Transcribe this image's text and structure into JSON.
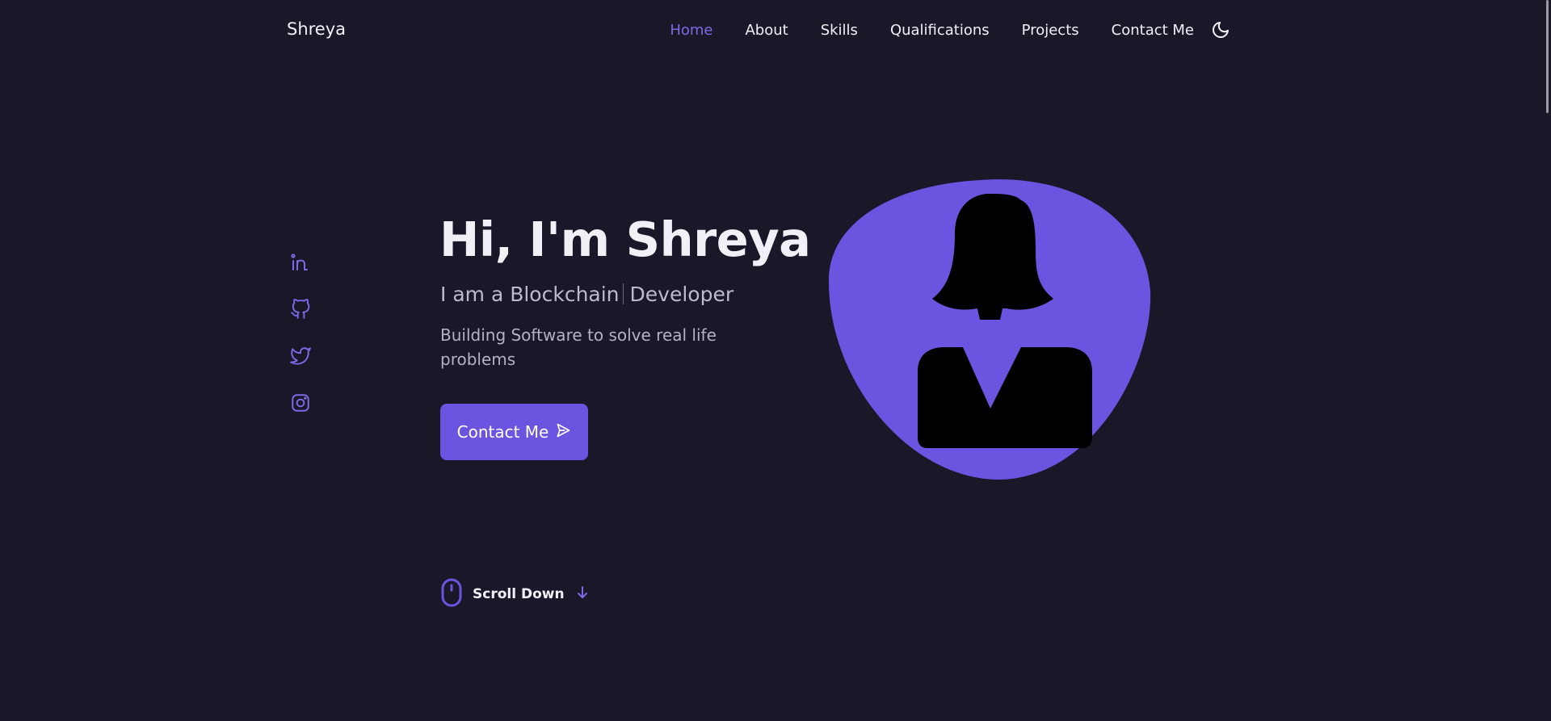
{
  "brand": {
    "name": "Shreya"
  },
  "nav": {
    "items": [
      {
        "label": "Home",
        "active": true
      },
      {
        "label": "About",
        "active": false
      },
      {
        "label": "Skills",
        "active": false
      },
      {
        "label": "Qualifications",
        "active": false
      },
      {
        "label": "Projects",
        "active": false
      },
      {
        "label": "Contact Me",
        "active": false
      }
    ],
    "theme_toggle_icon": "moon-icon"
  },
  "socials": [
    {
      "icon": "linkedin-icon"
    },
    {
      "icon": "github-icon"
    },
    {
      "icon": "twitter-icon"
    },
    {
      "icon": "instagram-icon"
    }
  ],
  "hero": {
    "title": "Hi, I'm Shreya",
    "subtitle_prefix": "I am a Blockchain",
    "subtitle_suffix": "Developer",
    "description": "Building Software to solve real life problems",
    "button_label": "Contact Me",
    "button_icon": "send-icon",
    "avatar_icon": "woman-avatar-icon"
  },
  "scroll": {
    "label": "Scroll Down",
    "icon": "mouse-icon",
    "arrow_icon": "arrow-down-icon"
  },
  "colors": {
    "accent": "#6b55e0",
    "nav_active": "#7b6ae6",
    "background": "#1a1728",
    "text": "#f1f0f7"
  }
}
